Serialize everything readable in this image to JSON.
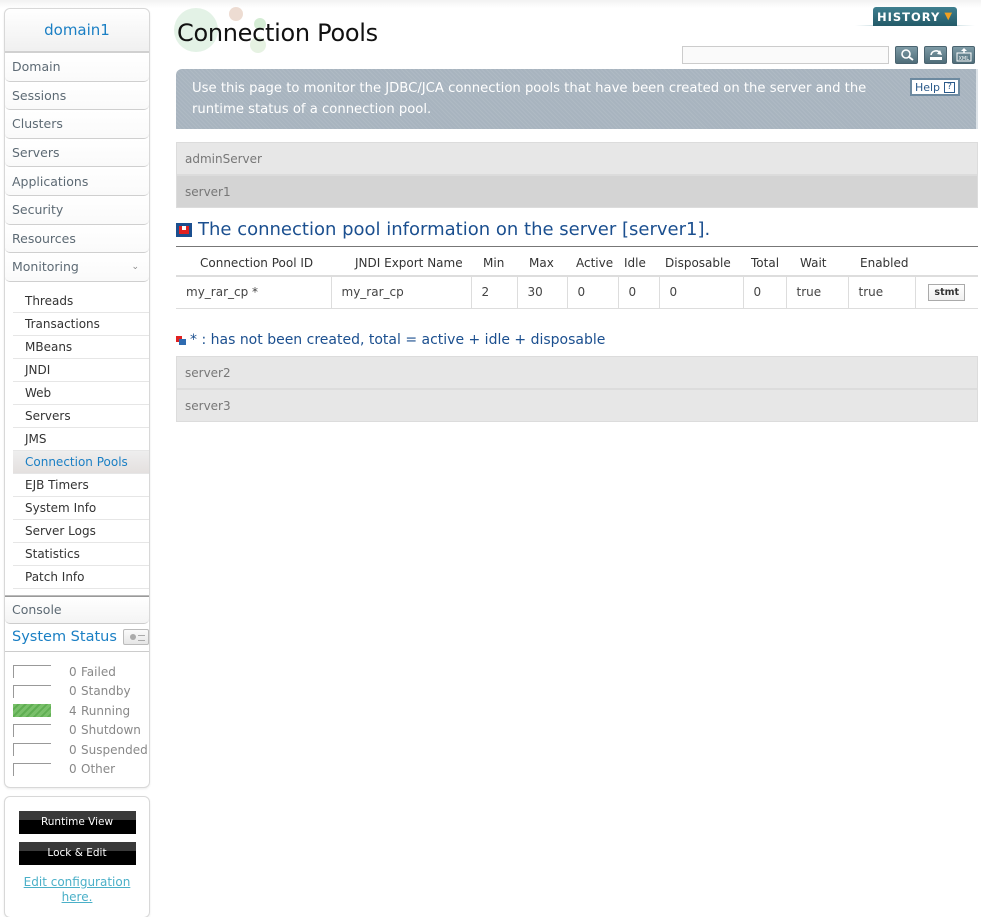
{
  "sidebar": {
    "domain": "domain1",
    "nav": [
      {
        "label": "Domain"
      },
      {
        "label": "Sessions"
      },
      {
        "label": "Clusters"
      },
      {
        "label": "Servers"
      },
      {
        "label": "Applications"
      },
      {
        "label": "Security"
      },
      {
        "label": "Resources"
      },
      {
        "label": "Monitoring",
        "expanded": true
      }
    ],
    "monitoring_items": [
      {
        "label": "Threads"
      },
      {
        "label": "Transactions"
      },
      {
        "label": "MBeans"
      },
      {
        "label": "JNDI"
      },
      {
        "label": "Web"
      },
      {
        "label": "Servers"
      },
      {
        "label": "JMS"
      },
      {
        "label": "Connection Pools",
        "active": true
      },
      {
        "label": "EJB Timers"
      },
      {
        "label": "System Info"
      },
      {
        "label": "Server Logs"
      },
      {
        "label": "Statistics"
      },
      {
        "label": "Patch Info"
      }
    ],
    "console": "Console",
    "system_status": {
      "title": "System Status",
      "rows": [
        {
          "count": "0",
          "label": "Failed"
        },
        {
          "count": "0",
          "label": "Standby"
        },
        {
          "count": "4",
          "label": "Running",
          "color": "#6ab85c"
        },
        {
          "count": "0",
          "label": "Shutdown"
        },
        {
          "count": "0",
          "label": "Suspended"
        },
        {
          "count": "0",
          "label": "Other"
        }
      ]
    },
    "runtime_view": "Runtime View",
    "lock_edit": "Lock & Edit",
    "edit_link_line1": "Edit configuration",
    "edit_link_line2": "here."
  },
  "header": {
    "title": "Connection Pools",
    "history": "HISTORY",
    "search_value": "",
    "info": "Use this page to monitor the JDBC/JCA connection pools that have been created on the server and the runtime status of a connection pool.",
    "help": "Help"
  },
  "servers_top": [
    "adminServer",
    "server1"
  ],
  "section_title": "The connection pool information on the server [server1].",
  "table": {
    "columns": [
      "Connection Pool ID",
      "JNDI Export Name",
      "Min",
      "Max",
      "Active",
      "Idle",
      "Disposable",
      "Total",
      "Wait",
      "Enabled",
      ""
    ],
    "rows": [
      {
        "id": "my_rar_cp *",
        "jndi": "my_rar_cp",
        "min": "2",
        "max": "30",
        "active": "0",
        "idle": "0",
        "disposable": "0",
        "total": "0",
        "wait": "true",
        "enabled": "true",
        "action": "stmt"
      }
    ]
  },
  "legend": "* : has not been created, total = active + idle + disposable",
  "servers_bottom": [
    "server2",
    "server3"
  ],
  "colors": {
    "accent": "#1a7fc4",
    "section": "#1b4f8f",
    "info_bg": "#a8b4bf",
    "history": "#2f6b7a"
  }
}
